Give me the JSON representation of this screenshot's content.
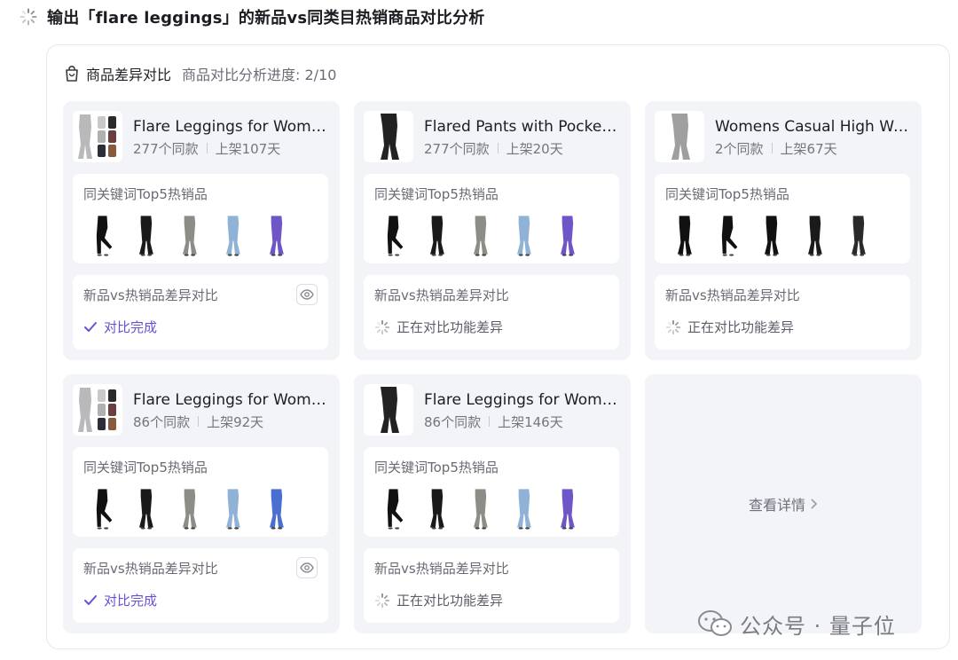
{
  "task": {
    "title": "输出「flare leggings」的新品vs同类目热销商品对比分析",
    "status_icon": "spinner-icon"
  },
  "panel": {
    "title": "商品差异对比",
    "progress": "商品对比分析进度: 2/10",
    "icon": "shopping-bag-icon"
  },
  "labels": {
    "keyword_section": "同关键词Top5热销品",
    "compare_section": "新品vs热销品差异对比"
  },
  "cards": [
    {
      "name": "Flare Leggings for Women High Waisted Yoga Pants",
      "same_count": "277个同款",
      "listed": "上架107天",
      "status": "done",
      "status_text": "对比完成",
      "has_view": true
    },
    {
      "name": "Flared Pants with Pockets for Women",
      "same_count": "277个同款",
      "listed": "上架20天",
      "status": "running",
      "status_text": "正在对比功能差异",
      "has_view": false
    },
    {
      "name": "Womens Casual High Waisted Flare Pants",
      "same_count": "2个同款",
      "listed": "上架67天",
      "status": "running",
      "status_text": "正在对比功能差异",
      "has_view": false
    },
    {
      "name": "Flare Leggings for Women Bootcut Yoga Pants",
      "same_count": "86个同款",
      "listed": "上架92天",
      "status": "done",
      "status_text": "对比完成",
      "has_view": true
    },
    {
      "name": "Flare Leggings for Women Crossover High Waist",
      "same_count": "86个同款",
      "listed": "上架146天",
      "status": "running",
      "status_text": "正在对比功能差异",
      "has_view": false
    }
  ],
  "details_link": "查看详情",
  "watermark": {
    "text": "公众号 · 量子位",
    "icon": "wechat-icon"
  },
  "colors": {
    "accent": "#6a4fd6",
    "card_bg": "#f3f4f7",
    "muted": "#75757f"
  }
}
